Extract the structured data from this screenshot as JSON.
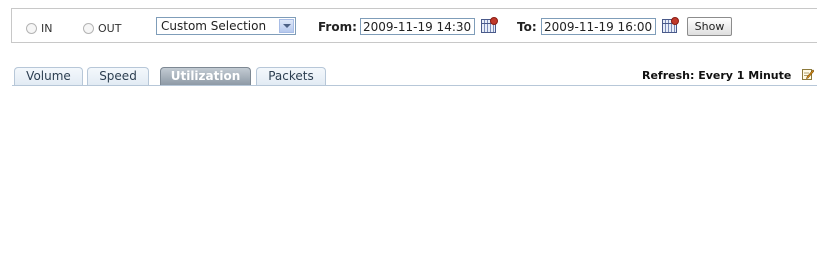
{
  "direction": {
    "options": [
      {
        "label": "IN",
        "selected": false
      },
      {
        "label": "OUT",
        "selected": false
      }
    ]
  },
  "range": {
    "selected": "Custom Selection",
    "from_label": "From:",
    "from_value": "2009-11-19 14:30",
    "to_label": "To:",
    "to_value": "2009-11-19 16:00",
    "show_label": "Show"
  },
  "tabs": [
    {
      "label": "Volume",
      "active": false
    },
    {
      "label": "Speed",
      "active": false
    },
    {
      "label": "Utilization",
      "active": true
    },
    {
      "label": "Packets",
      "active": false
    }
  ],
  "refresh": {
    "label": "Refresh: Every 1 Minute",
    "icon": "edit-icon"
  },
  "icons": {
    "calendar": "calendar-icon",
    "dropdown": "chevron-down-icon"
  }
}
